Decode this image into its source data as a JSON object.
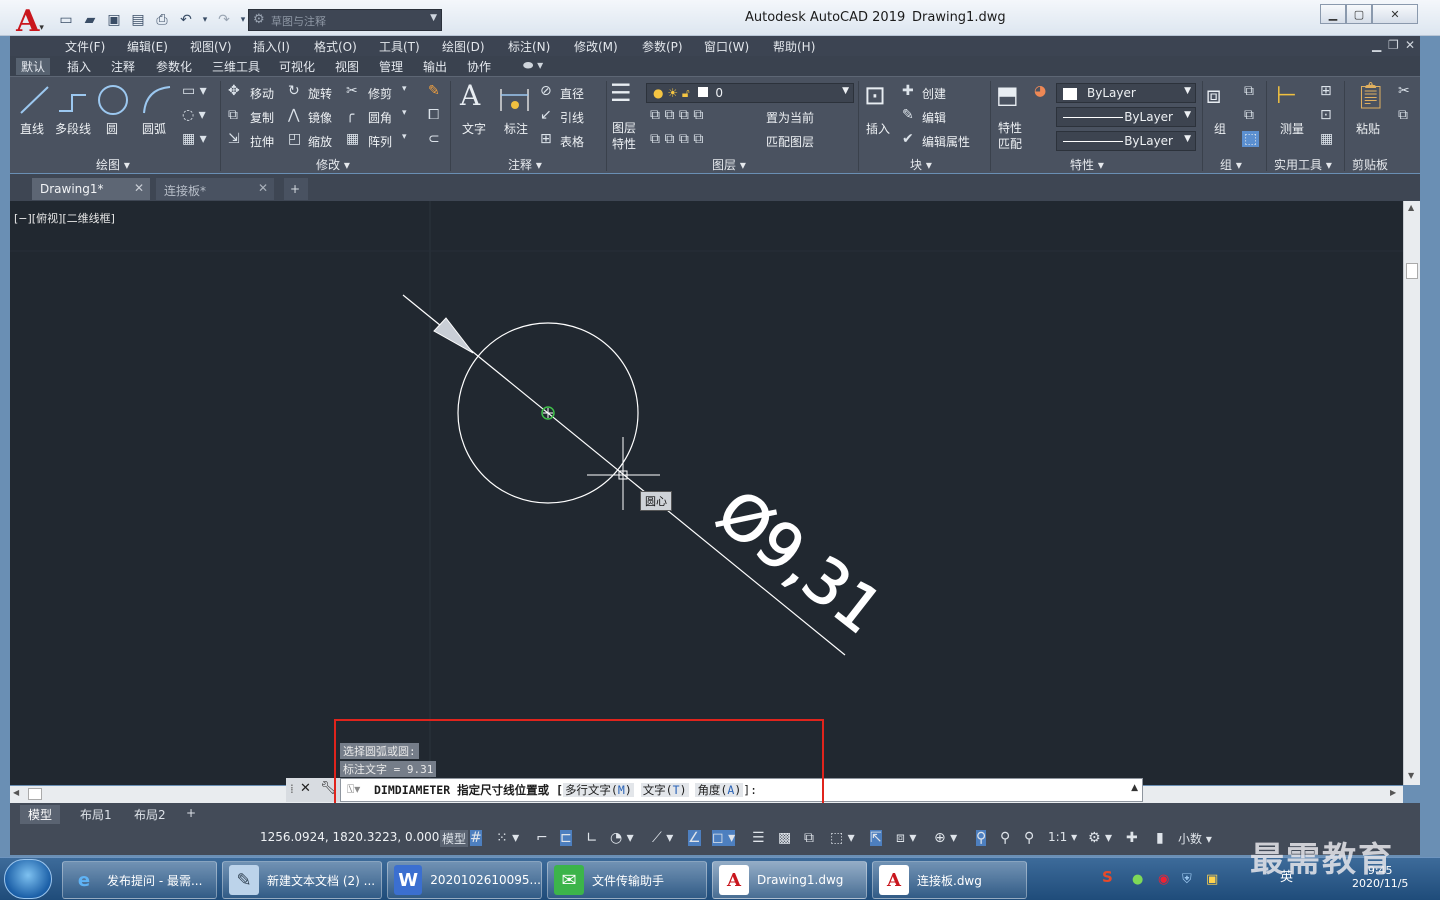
{
  "titlebar": {
    "app_title": "Autodesk AutoCAD 2019",
    "doc_name": "Drawing1.dwg",
    "workspace": "草图与注释"
  },
  "menu": [
    "文件(F)",
    "编辑(E)",
    "视图(V)",
    "插入(I)",
    "格式(O)",
    "工具(T)",
    "绘图(D)",
    "标注(N)",
    "修改(M)",
    "参数(P)",
    "窗口(W)",
    "帮助(H)"
  ],
  "ribbon_tabs": [
    "默认",
    "插入",
    "注释",
    "参数化",
    "三维工具",
    "可视化",
    "视图",
    "管理",
    "输出",
    "协作"
  ],
  "ribbon": {
    "draw": {
      "title": "绘图",
      "line": "直线",
      "polyline": "多段线",
      "circle": "圆",
      "arc": "圆弧"
    },
    "modify": {
      "title": "修改",
      "move": "移动",
      "rotate": "旋转",
      "trim": "修剪",
      "copy": "复制",
      "mirror": "镜像",
      "fillet": "圆角",
      "stretch": "拉伸",
      "scale": "缩放",
      "array": "阵列"
    },
    "annotation": {
      "title": "注释",
      "text": "文字",
      "dimension": "标注",
      "diameter": "直径",
      "leader": "引线",
      "table": "表格"
    },
    "layers": {
      "title": "图层",
      "layer_props": "图层特性",
      "current_layer": "0",
      "set_current": "置为当前",
      "match_layer": "匹配图层"
    },
    "block": {
      "title": "块",
      "insert": "插入",
      "create": "创建",
      "edit": "编辑",
      "edit_attr": "编辑属性"
    },
    "properties": {
      "title": "特性",
      "match": "特性匹配",
      "color": "ByLayer",
      "linetype": "ByLayer",
      "lineweight": "ByLayer"
    },
    "groups": {
      "title": "组",
      "group": "组"
    },
    "utilities": {
      "title": "实用工具",
      "measure": "测量"
    },
    "clipboard": {
      "title": "剪贴板",
      "paste": "粘贴"
    }
  },
  "doc_tabs": [
    {
      "label": "Drawing1*"
    },
    {
      "label": "连接板*"
    }
  ],
  "viewport_label": "[−][俯视][二维线框]",
  "drawing": {
    "dimension_text": "Ø9,31",
    "snap_tooltip": "圆心"
  },
  "command": {
    "history": [
      "选择圆弧或圆:",
      "标注文字 = 9.31"
    ],
    "prompt_cmd": "DIMDIAMETER 指定尺寸线位置或 [",
    "opt1": "多行文字(",
    "opt1_key": "M",
    "opt2": "文字(",
    "opt2_key": "T",
    "opt3": "角度(",
    "opt3_key": "A",
    "close_paren": ")",
    "prompt_end": "]:"
  },
  "layout_tabs": [
    "模型",
    "布局1",
    "布局2"
  ],
  "status": {
    "coords": "1256.0924, 1820.3223, 0.0000",
    "model": "模型",
    "scale": "1:1",
    "units": "小数"
  },
  "taskbar": {
    "items": [
      "发布提问 - 最需...",
      "新建文本文档 (2) ...",
      "2020102610095...",
      "文件传输助手",
      "Drawing1.dwg",
      "连接板.dwg"
    ],
    "time": "9:45",
    "date": "2020/11/5",
    "ime": "英",
    "watermark": "最需教育"
  }
}
